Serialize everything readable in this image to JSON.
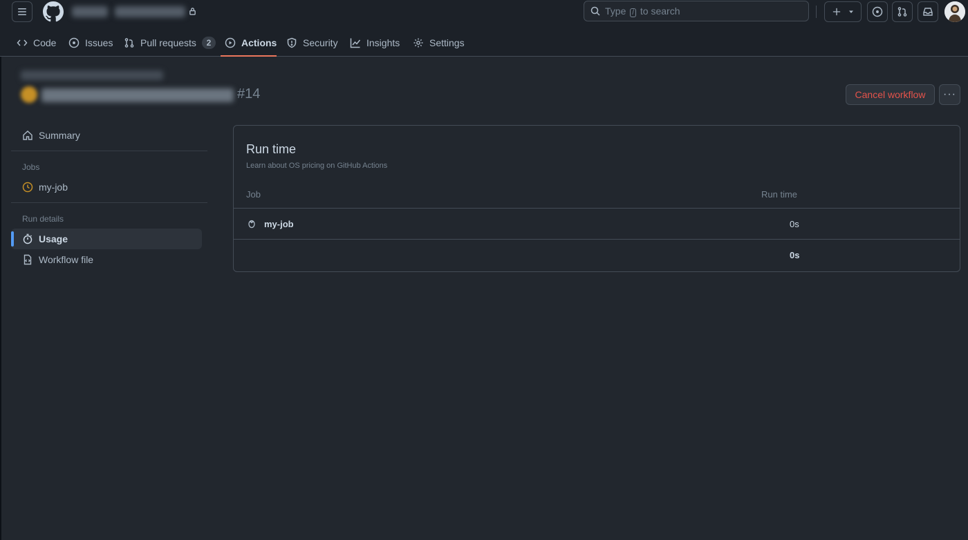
{
  "header": {
    "search_pre": "Type",
    "search_key": "/",
    "search_post": "to search"
  },
  "tabs": [
    {
      "label": "Code"
    },
    {
      "label": "Issues"
    },
    {
      "label": "Pull requests",
      "count": "2"
    },
    {
      "label": "Actions",
      "active": true
    },
    {
      "label": "Security"
    },
    {
      "label": "Insights"
    },
    {
      "label": "Settings"
    }
  ],
  "run": {
    "number": "#14",
    "cancel_label": "Cancel workflow",
    "more_label": "···"
  },
  "sidebar": {
    "summary": "Summary",
    "jobs_heading": "Jobs",
    "job": "my-job",
    "details_heading": "Run details",
    "usage": "Usage",
    "workflow_file": "Workflow file"
  },
  "usage_panel": {
    "title": "Run time",
    "subtitle": "Learn about OS pricing on GitHub Actions",
    "columns": [
      "Job",
      "Run time"
    ],
    "rows": [
      {
        "job": "my-job",
        "time": "0s"
      }
    ],
    "total": "0s"
  },
  "colors": {
    "accent": "#ec775c",
    "danger": "#e5534b",
    "selected_bar": "#539bf5",
    "in_progress": "#c69026"
  }
}
